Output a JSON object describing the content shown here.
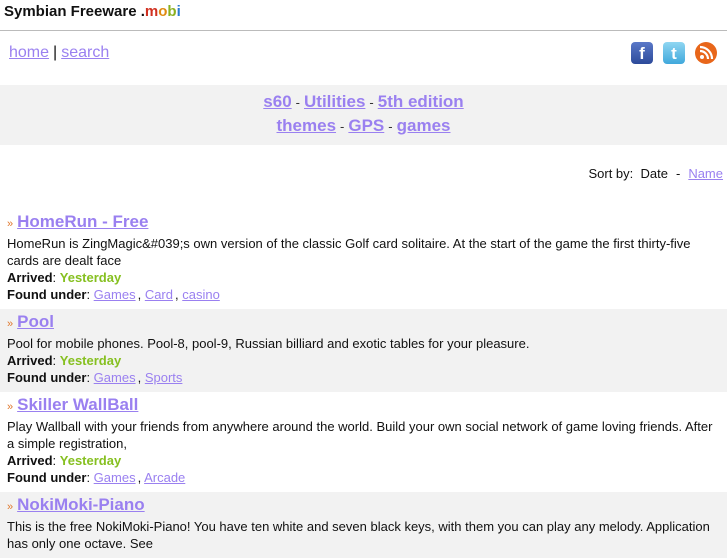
{
  "header": {
    "title_main": "Symbian Freeware .",
    "title_m": "m",
    "title_o": "o",
    "title_b": "b",
    "title_i": "i"
  },
  "nav": {
    "home": "home",
    "separator": "|",
    "search": "search"
  },
  "social": [
    {
      "icon": "facebook-icon",
      "glyph": "f"
    },
    {
      "icon": "twitter-icon",
      "glyph": "t"
    },
    {
      "icon": "rss-icon",
      "glyph": ")"
    }
  ],
  "categories": {
    "row1": [
      "s60",
      "Utilities",
      "5th edition"
    ],
    "row2": [
      "themes",
      "GPS",
      "games"
    ],
    "dash": "-"
  },
  "sort": {
    "label": "Sort by:",
    "date": "Date",
    "dash": "-",
    "name": "Name"
  },
  "labels": {
    "arrived": "Arrived",
    "found": "Found under",
    "colon": ": ",
    "raquo": "»"
  },
  "items": [
    {
      "title": "HomeRun - Free",
      "desc": "HomeRun is ZingMagic&#039;s own version of the classic Golf card solitaire. At the start of the game the first thirty-five cards are dealt face",
      "arrived": "Yesterday",
      "tags": [
        "Games",
        "Card",
        "casino"
      ]
    },
    {
      "title": "Pool",
      "desc": "Pool for mobile phones. Pool-8, pool-9, Russian billiard and exotic tables for your pleasure.",
      "arrived": "Yesterday",
      "tags": [
        "Games",
        "Sports"
      ]
    },
    {
      "title": "Skiller WallBall",
      "desc": "Play Wallball with your friends from anywhere around the world. Build your own social network of game loving friends. After a simple registration,",
      "arrived": "Yesterday",
      "tags": [
        "Games",
        "Arcade"
      ]
    },
    {
      "title": "NokiMoki-Piano",
      "desc": "This is the free NokiMoki-Piano! You have ten white and seven black keys, with them you can play any melody. Application has only one octave. See",
      "arrived": "",
      "tags": []
    }
  ],
  "colors": {
    "link": "#9a80f0",
    "arrived": "#86c020",
    "band": "#f2f2f2"
  }
}
